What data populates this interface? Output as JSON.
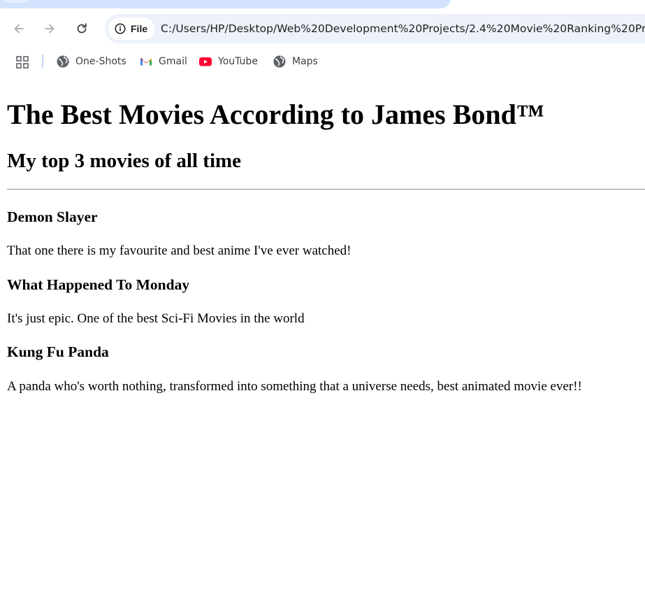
{
  "browser": {
    "chip_label": "File",
    "url": "C:/Users/HP/Desktop/Web%20Development%20Projects/2.4%20Movie%20Ranking%20Pro",
    "back_icon": "back-arrow-icon",
    "forward_icon": "forward-arrow-icon",
    "reload_icon": "reload-icon",
    "info_icon": "info-icon",
    "bookmarks": [
      {
        "label": "One-Shots",
        "icon": "globe-icon"
      },
      {
        "label": "Gmail",
        "icon": "gmail-icon"
      },
      {
        "label": "YouTube",
        "icon": "youtube-icon"
      },
      {
        "label": "Maps",
        "icon": "globe-icon"
      }
    ]
  },
  "page": {
    "title": "The Best Movies According to James Bond™",
    "subtitle": "My top 3 movies of all time",
    "movies": [
      {
        "title": "Demon Slayer",
        "description": "That one there is my favourite and best anime I've ever watched!"
      },
      {
        "title": "What Happened To Monday",
        "description": "It's just epic. One of the best Sci-Fi Movies in the world"
      },
      {
        "title": "Kung Fu Panda",
        "description": "A panda who's worth nothing, transformed into something that a universe needs, best animated movie ever!!"
      }
    ]
  }
}
